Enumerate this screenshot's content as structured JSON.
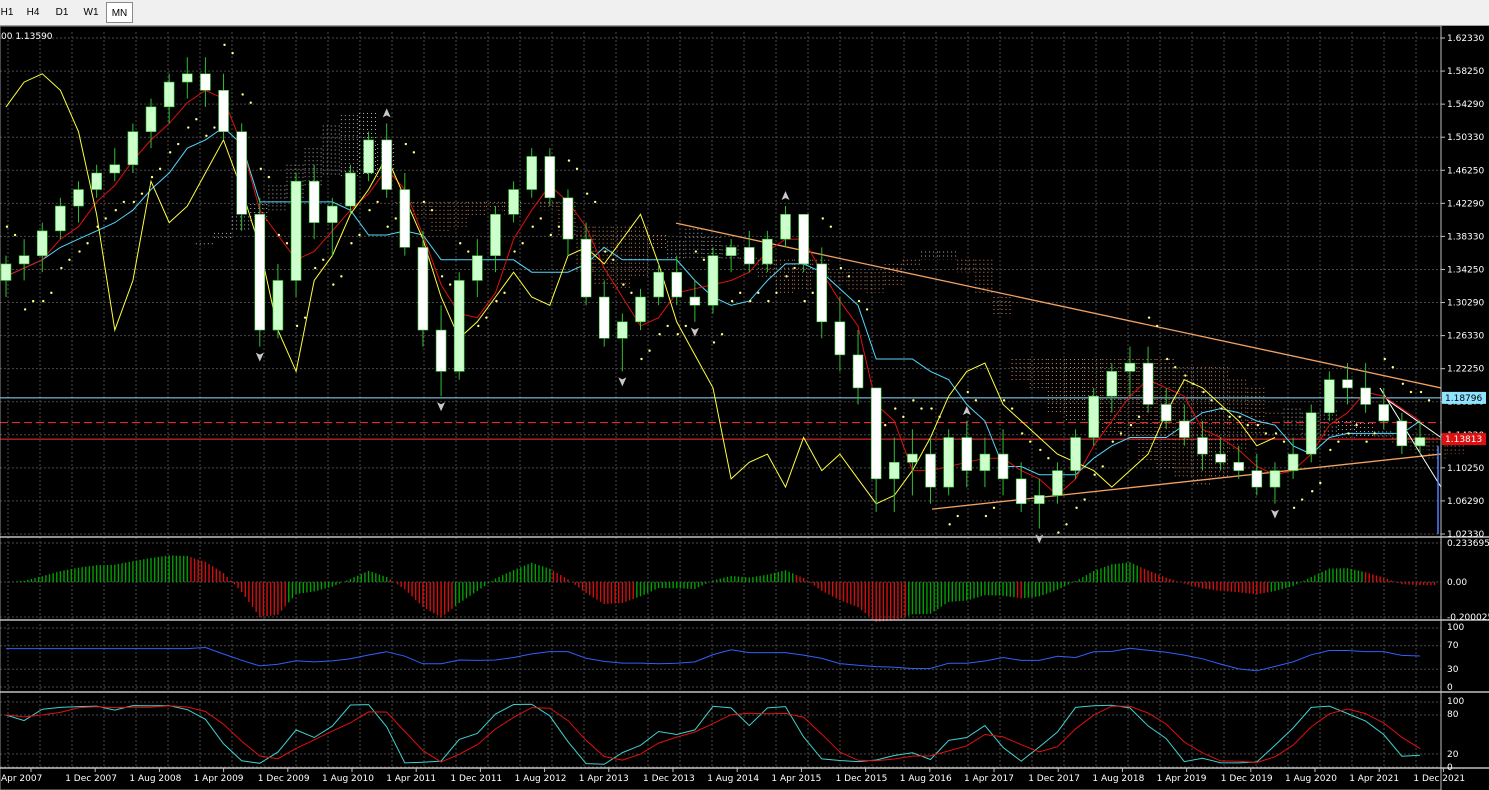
{
  "toolbar": {
    "timeframes": [
      {
        "label": "H1",
        "active": false
      },
      {
        "label": "H4",
        "active": false
      },
      {
        "label": "D1",
        "active": false
      },
      {
        "label": "W1",
        "active": false
      },
      {
        "label": "MN",
        "active": true
      }
    ]
  },
  "chart_info": "00 1.13590",
  "price_axis": {
    "labels": [
      "1.62330",
      "1.58250",
      "1.54290",
      "1.50330",
      "1.46250",
      "1.42290",
      "1.38330",
      "1.34250",
      "1.30290",
      "1.26330",
      "1.22250",
      "1.18270",
      "1.14320",
      "1.10250",
      "1.06290",
      "1.02330"
    ],
    "range": [
      1.0233,
      1.6233
    ],
    "tags": [
      {
        "value": "1.18796",
        "price": 1.18796,
        "color": "#8fe3ff",
        "text_color": "#000000"
      },
      {
        "value": "1.13813",
        "price": 1.13813,
        "color": "#e01010",
        "text_color": "#ffffff"
      }
    ]
  },
  "horizontal_lines": [
    {
      "price": 1.18796,
      "color": "#8fe3ff",
      "style": "solid"
    },
    {
      "price": 1.158,
      "color": "#ff3030",
      "style": "dashed"
    },
    {
      "price": 1.1381,
      "color": "#ff3030",
      "style": "solid"
    }
  ],
  "time_axis": {
    "labels": [
      "Apr 2007",
      "1 Dec 2007",
      "1 Aug 2008",
      "1 Apr 2009",
      "1 Dec 2009",
      "1 Aug 2010",
      "1 Apr 2011",
      "1 Dec 2011",
      "1 Aug 2012",
      "1 Apr 2013",
      "1 Dec 2013",
      "1 Aug 2014",
      "1 Apr 2015",
      "1 Dec 2015",
      "1 Aug 2016",
      "1 Apr 2017",
      "1 Dec 2017",
      "1 Aug 2018",
      "1 Apr 2019",
      "1 Dec 2019",
      "1 Aug 2020",
      "1 Apr 2021",
      "1 Dec 2021"
    ]
  },
  "macd_panel": {
    "labels": [
      "0.233695",
      "0.00",
      "-0.200025"
    ],
    "range": [
      -0.200025,
      0.233695
    ]
  },
  "rsi_panel": {
    "labels": [
      "100",
      "70",
      "30",
      "0"
    ],
    "levels": [
      100,
      70,
      30,
      0
    ]
  },
  "stoch_panel": {
    "labels": [
      "100",
      "80",
      "20",
      "0"
    ],
    "levels": [
      100,
      80,
      20,
      0
    ]
  },
  "colors": {
    "background": "#000000",
    "grid": "#4a4a4a",
    "bull_candle": "#ccffcc",
    "bear_candle": "#ffffff",
    "wick": "#30c030",
    "tenkan": "#e01010",
    "kijun": "#50d8ff",
    "chikou": "#ffff40",
    "trendline": "#f0a060",
    "macd_up": "#00a000",
    "macd_down": "#d01010",
    "rsi": "#3060ff",
    "stoch_main": "#40d0d0",
    "stoch_signal": "#e01010"
  },
  "chart_data": {
    "type": "candlestick",
    "symbol_timeframe": "MN",
    "ohlc_approx": [
      [
        1.33,
        1.36,
        1.31,
        1.35
      ],
      [
        1.35,
        1.38,
        1.33,
        1.36
      ],
      [
        1.36,
        1.4,
        1.34,
        1.39
      ],
      [
        1.39,
        1.43,
        1.38,
        1.42
      ],
      [
        1.42,
        1.45,
        1.4,
        1.44
      ],
      [
        1.44,
        1.47,
        1.43,
        1.46
      ],
      [
        1.46,
        1.49,
        1.45,
        1.47
      ],
      [
        1.47,
        1.52,
        1.46,
        1.51
      ],
      [
        1.51,
        1.55,
        1.49,
        1.54
      ],
      [
        1.54,
        1.58,
        1.52,
        1.57
      ],
      [
        1.57,
        1.6,
        1.55,
        1.58
      ],
      [
        1.58,
        1.6,
        1.54,
        1.56
      ],
      [
        1.56,
        1.58,
        1.5,
        1.51
      ],
      [
        1.51,
        1.52,
        1.39,
        1.41
      ],
      [
        1.41,
        1.43,
        1.25,
        1.27
      ],
      [
        1.27,
        1.35,
        1.26,
        1.33
      ],
      [
        1.33,
        1.46,
        1.31,
        1.45
      ],
      [
        1.45,
        1.47,
        1.38,
        1.4
      ],
      [
        1.4,
        1.43,
        1.36,
        1.42
      ],
      [
        1.42,
        1.47,
        1.41,
        1.46
      ],
      [
        1.46,
        1.51,
        1.45,
        1.5
      ],
      [
        1.5,
        1.52,
        1.43,
        1.44
      ],
      [
        1.44,
        1.46,
        1.36,
        1.37
      ],
      [
        1.37,
        1.39,
        1.25,
        1.27
      ],
      [
        1.27,
        1.3,
        1.19,
        1.22
      ],
      [
        1.22,
        1.34,
        1.21,
        1.33
      ],
      [
        1.33,
        1.38,
        1.31,
        1.36
      ],
      [
        1.36,
        1.42,
        1.34,
        1.41
      ],
      [
        1.41,
        1.45,
        1.4,
        1.44
      ],
      [
        1.44,
        1.49,
        1.43,
        1.48
      ],
      [
        1.48,
        1.49,
        1.42,
        1.43
      ],
      [
        1.43,
        1.44,
        1.36,
        1.38
      ],
      [
        1.38,
        1.4,
        1.3,
        1.31
      ],
      [
        1.31,
        1.33,
        1.25,
        1.26
      ],
      [
        1.26,
        1.29,
        1.22,
        1.28
      ],
      [
        1.28,
        1.32,
        1.27,
        1.31
      ],
      [
        1.31,
        1.35,
        1.3,
        1.34
      ],
      [
        1.34,
        1.36,
        1.3,
        1.31
      ],
      [
        1.31,
        1.33,
        1.28,
        1.3
      ],
      [
        1.3,
        1.37,
        1.29,
        1.36
      ],
      [
        1.36,
        1.38,
        1.34,
        1.37
      ],
      [
        1.37,
        1.39,
        1.34,
        1.35
      ],
      [
        1.35,
        1.39,
        1.34,
        1.38
      ],
      [
        1.38,
        1.42,
        1.37,
        1.41
      ],
      [
        1.41,
        1.39,
        1.34,
        1.35
      ],
      [
        1.35,
        1.37,
        1.26,
        1.28
      ],
      [
        1.28,
        1.31,
        1.22,
        1.24
      ],
      [
        1.24,
        1.27,
        1.18,
        1.2
      ],
      [
        1.2,
        1.13,
        1.05,
        1.09
      ],
      [
        1.09,
        1.14,
        1.05,
        1.11
      ],
      [
        1.11,
        1.15,
        1.07,
        1.12
      ],
      [
        1.12,
        1.14,
        1.06,
        1.08
      ],
      [
        1.08,
        1.15,
        1.07,
        1.14
      ],
      [
        1.14,
        1.16,
        1.08,
        1.1
      ],
      [
        1.1,
        1.14,
        1.08,
        1.12
      ],
      [
        1.12,
        1.15,
        1.07,
        1.09
      ],
      [
        1.09,
        1.11,
        1.05,
        1.06
      ],
      [
        1.06,
        1.09,
        1.03,
        1.07
      ],
      [
        1.07,
        1.11,
        1.06,
        1.1
      ],
      [
        1.1,
        1.15,
        1.09,
        1.14
      ],
      [
        1.14,
        1.2,
        1.13,
        1.19
      ],
      [
        1.19,
        1.23,
        1.17,
        1.22
      ],
      [
        1.22,
        1.25,
        1.19,
        1.23
      ],
      [
        1.23,
        1.25,
        1.17,
        1.18
      ],
      [
        1.18,
        1.2,
        1.15,
        1.16
      ],
      [
        1.16,
        1.18,
        1.13,
        1.14
      ],
      [
        1.14,
        1.16,
        1.1,
        1.12
      ],
      [
        1.12,
        1.14,
        1.1,
        1.11
      ],
      [
        1.11,
        1.13,
        1.09,
        1.1
      ],
      [
        1.1,
        1.12,
        1.07,
        1.08
      ],
      [
        1.08,
        1.11,
        1.06,
        1.1
      ],
      [
        1.1,
        1.14,
        1.09,
        1.12
      ],
      [
        1.12,
        1.18,
        1.11,
        1.17
      ],
      [
        1.17,
        1.22,
        1.16,
        1.21
      ],
      [
        1.21,
        1.23,
        1.18,
        1.2
      ],
      [
        1.2,
        1.23,
        1.17,
        1.18
      ],
      [
        1.18,
        1.2,
        1.15,
        1.16
      ],
      [
        1.16,
        1.17,
        1.12,
        1.13
      ],
      [
        1.13,
        1.16,
        1.12,
        1.14
      ]
    ],
    "trendlines": [
      {
        "from": {
          "time": "1 Dec 2013",
          "price": 1.3993
        },
        "to": {
          "time": "1 Dec 2021",
          "price": 1.2
        }
      },
      {
        "from": {
          "time": "1 Aug 2016",
          "price": 1.0534
        },
        "to": {
          "time": "1 Dec 2021",
          "price": 1.12
        }
      }
    ]
  }
}
